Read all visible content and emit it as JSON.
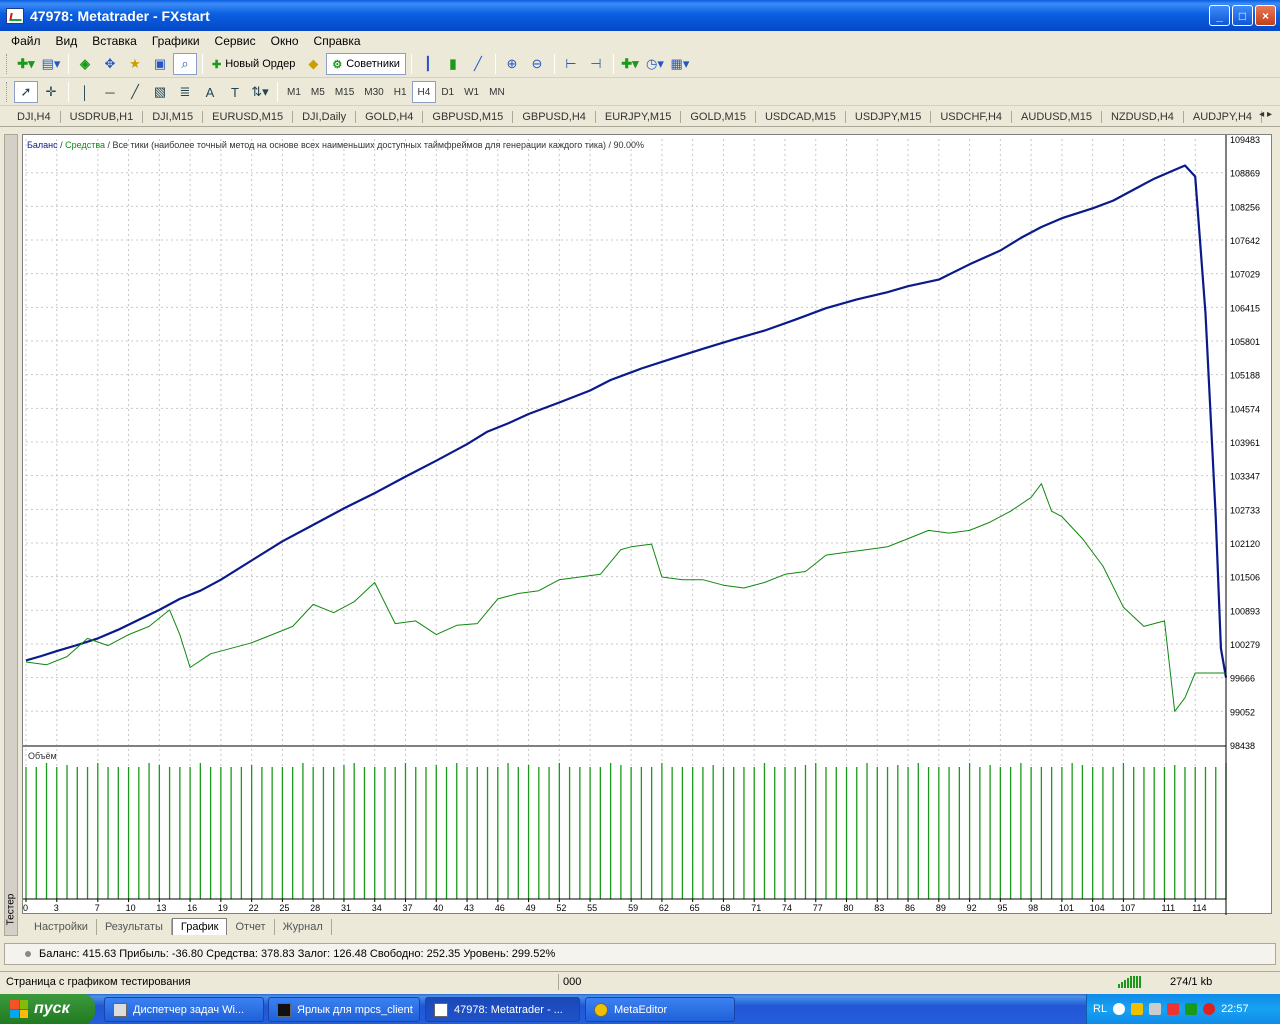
{
  "window": {
    "title": "47978: Metatrader - FXstart",
    "minimize_label": "_",
    "maximize_label": "□",
    "close_label": "×"
  },
  "menu": [
    "Файл",
    "Вид",
    "Вставка",
    "Графики",
    "Сервис",
    "Окно",
    "Справка"
  ],
  "toolbar": {
    "new_order": "Новый Ордер",
    "experts": "Советники"
  },
  "timeframes": [
    "M1",
    "M5",
    "M15",
    "M30",
    "H1",
    "H4",
    "D1",
    "W1",
    "MN"
  ],
  "timeframe_selected": "H4",
  "chart_tabs": [
    "DJI,H4",
    "USDRUB,H1",
    "DJI,M15",
    "EURUSD,M15",
    "DJI,Daily",
    "GOLD,H4",
    "GBPUSD,M15",
    "GBPUSD,H4",
    "EURJPY,M15",
    "GOLD,M15",
    "USDCAD,M15",
    "USDJPY,M15",
    "USDCHF,H4",
    "AUDUSD,M15",
    "NZDUSD,H4",
    "AUDJPY,H4"
  ],
  "legend": {
    "balance": "Баланс",
    "sep": " / ",
    "equity": "Средства",
    "rest": " / Все тики (наиболее точный метод на основе всех наименьших доступных таймфреймов для генерации каждого тика) / 90.00%"
  },
  "volume_label": "Объём",
  "side_label": "Тестер",
  "bottom_tabs": [
    "Настройки",
    "Результаты",
    "График",
    "Отчет",
    "Журнал"
  ],
  "bottom_tab_active": "График",
  "account_line": "Баланс: 415.63  Прибыль: -36.80  Средства: 378.83  Залог: 126.48  Свободно: 252.35  Уровень: 299.52%",
  "status": {
    "text": "Страница с графиком тестирования",
    "code": "000",
    "size": "274/1 kb"
  },
  "taskbar": {
    "start": "пуск",
    "tasks": [
      "Диспетчер задач Wi...",
      "Ярлык для mpcs_client",
      "47978: Metatrader - ...",
      "MetaEditor"
    ],
    "active_task": 2,
    "lang": "RL",
    "clock": "22:57"
  },
  "colors": {
    "balance": "#0a1a8a",
    "equity": "#108810",
    "volume": "#1a9a1a",
    "grid": "#c8c8c8"
  },
  "chart_data": {
    "type": "line",
    "y_ticks": [
      109483,
      108869,
      108256,
      107642,
      107029,
      106415,
      105801,
      105188,
      104574,
      103961,
      103347,
      102733,
      102120,
      101506,
      100893,
      100279,
      99666,
      99052,
      98438
    ],
    "ylim": [
      98438,
      109483
    ],
    "x_ticks": [
      0,
      3,
      7,
      10,
      13,
      16,
      19,
      22,
      25,
      28,
      31,
      34,
      37,
      40,
      43,
      46,
      49,
      52,
      55,
      59,
      62,
      65,
      68,
      71,
      74,
      77,
      80,
      83,
      86,
      89,
      92,
      95,
      98,
      101,
      104,
      107,
      111,
      114
    ],
    "xlim": [
      0,
      117
    ],
    "series": [
      {
        "name": "Баланс",
        "x": [
          0,
          1.5,
          3,
          5,
          7,
          9,
          11,
          13,
          15,
          17,
          19,
          22,
          25,
          28,
          31,
          34,
          37,
          40,
          43,
          45,
          47,
          49,
          52,
          55,
          57,
          60,
          63,
          66,
          69,
          72,
          75,
          78,
          81,
          84,
          86,
          89,
          92,
          95,
          97,
          99,
          101,
          104,
          106,
          108,
          110,
          112,
          113,
          114,
          115,
          116,
          116.5,
          117
        ],
        "y": [
          99980,
          100060,
          100150,
          100260,
          100380,
          100540,
          100720,
          100900,
          101100,
          101250,
          101450,
          101800,
          102150,
          102450,
          102750,
          103030,
          103330,
          103620,
          103920,
          104150,
          104300,
          104470,
          104680,
          104900,
          105090,
          105300,
          105480,
          105660,
          105830,
          105990,
          106190,
          106400,
          106560,
          106690,
          106800,
          106920,
          107200,
          107450,
          107680,
          107880,
          108040,
          108220,
          108360,
          108560,
          108760,
          108920,
          109000,
          108800,
          106300,
          102600,
          100200,
          99666
        ]
      },
      {
        "name": "Средства",
        "x": [
          0,
          2,
          4,
          6,
          8,
          10,
          12,
          14,
          15,
          16,
          18,
          20,
          22,
          24,
          26,
          28,
          30,
          32,
          34,
          36,
          38,
          40,
          42,
          44,
          46,
          48,
          50,
          52,
          54,
          56,
          58,
          59,
          61,
          62,
          64,
          66,
          68,
          70,
          72,
          74,
          76,
          78,
          80,
          82,
          84,
          86,
          88,
          90,
          92,
          94,
          96,
          98,
          99,
          100,
          101,
          103,
          105,
          107,
          109,
          111,
          112,
          113,
          114,
          115,
          116,
          117
        ],
        "y": [
          99950,
          99900,
          100050,
          100380,
          100250,
          100450,
          100600,
          100900,
          100450,
          99850,
          100100,
          100200,
          100300,
          100450,
          100600,
          101000,
          100850,
          101050,
          101400,
          100650,
          100700,
          100450,
          100620,
          100650,
          101100,
          101200,
          101250,
          101450,
          101500,
          101550,
          102000,
          102050,
          102100,
          101500,
          101450,
          101450,
          101350,
          101300,
          101400,
          101550,
          101600,
          101900,
          101950,
          102000,
          102050,
          102200,
          102350,
          102300,
          102350,
          102500,
          102700,
          102950,
          103200,
          102700,
          102600,
          102200,
          101700,
          100950,
          100600,
          100700,
          99050,
          99300,
          99750,
          99750,
          99750,
          99750
        ]
      }
    ],
    "volume": {
      "name": "Объём",
      "bar_count": 118
    }
  }
}
